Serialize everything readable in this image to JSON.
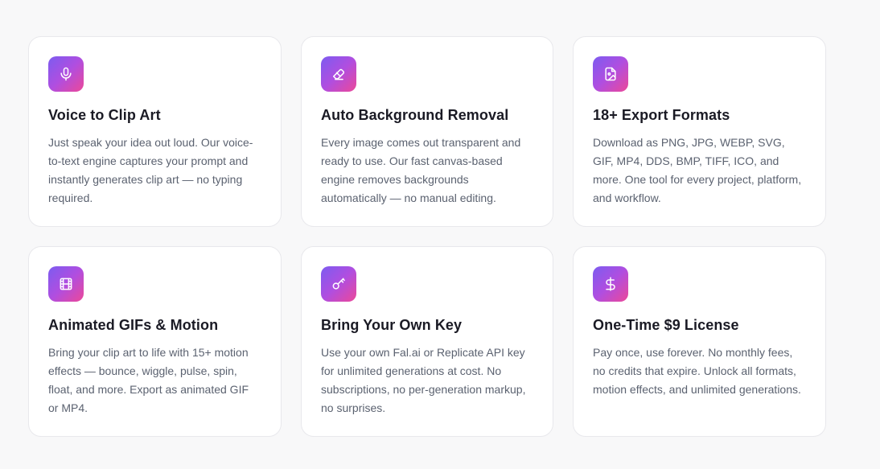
{
  "features": [
    {
      "icon": "microphone-icon",
      "title": "Voice to Clip Art",
      "description": "Just speak your idea out loud. Our voice-to-text engine captures your prompt and instantly generates clip art — no typing required."
    },
    {
      "icon": "eraser-icon",
      "title": "Auto Background Removal",
      "description": "Every image comes out transparent and ready to use. Our fast canvas-based engine removes backgrounds automatically — no manual editing."
    },
    {
      "icon": "file-image-icon",
      "title": "18+ Export Formats",
      "description": "Download as PNG, JPG, WEBP, SVG, GIF, MP4, DDS, BMP, TIFF, ICO, and more. One tool for every project, platform, and workflow."
    },
    {
      "icon": "film-icon",
      "title": "Animated GIFs & Motion",
      "description": "Bring your clip art to life with 15+ motion effects — bounce, wiggle, pulse, spin, float, and more. Export as animated GIF or MP4."
    },
    {
      "icon": "key-icon",
      "title": "Bring Your Own Key",
      "description": "Use your own Fal.ai or Replicate API key for unlimited generations at cost. No subscriptions, no per-generation markup, no surprises."
    },
    {
      "icon": "dollar-icon",
      "title": "One-Time $9 License",
      "description": "Pay once, use forever. No monthly fees, no credits that expire. Unlock all formats, motion effects, and unlimited generations."
    }
  ],
  "colors": {
    "gradient_start": "#7c5cf0",
    "gradient_end": "#ec4899",
    "title": "#1a1a24",
    "text": "#5b6270",
    "background": "#f8f8f9"
  }
}
